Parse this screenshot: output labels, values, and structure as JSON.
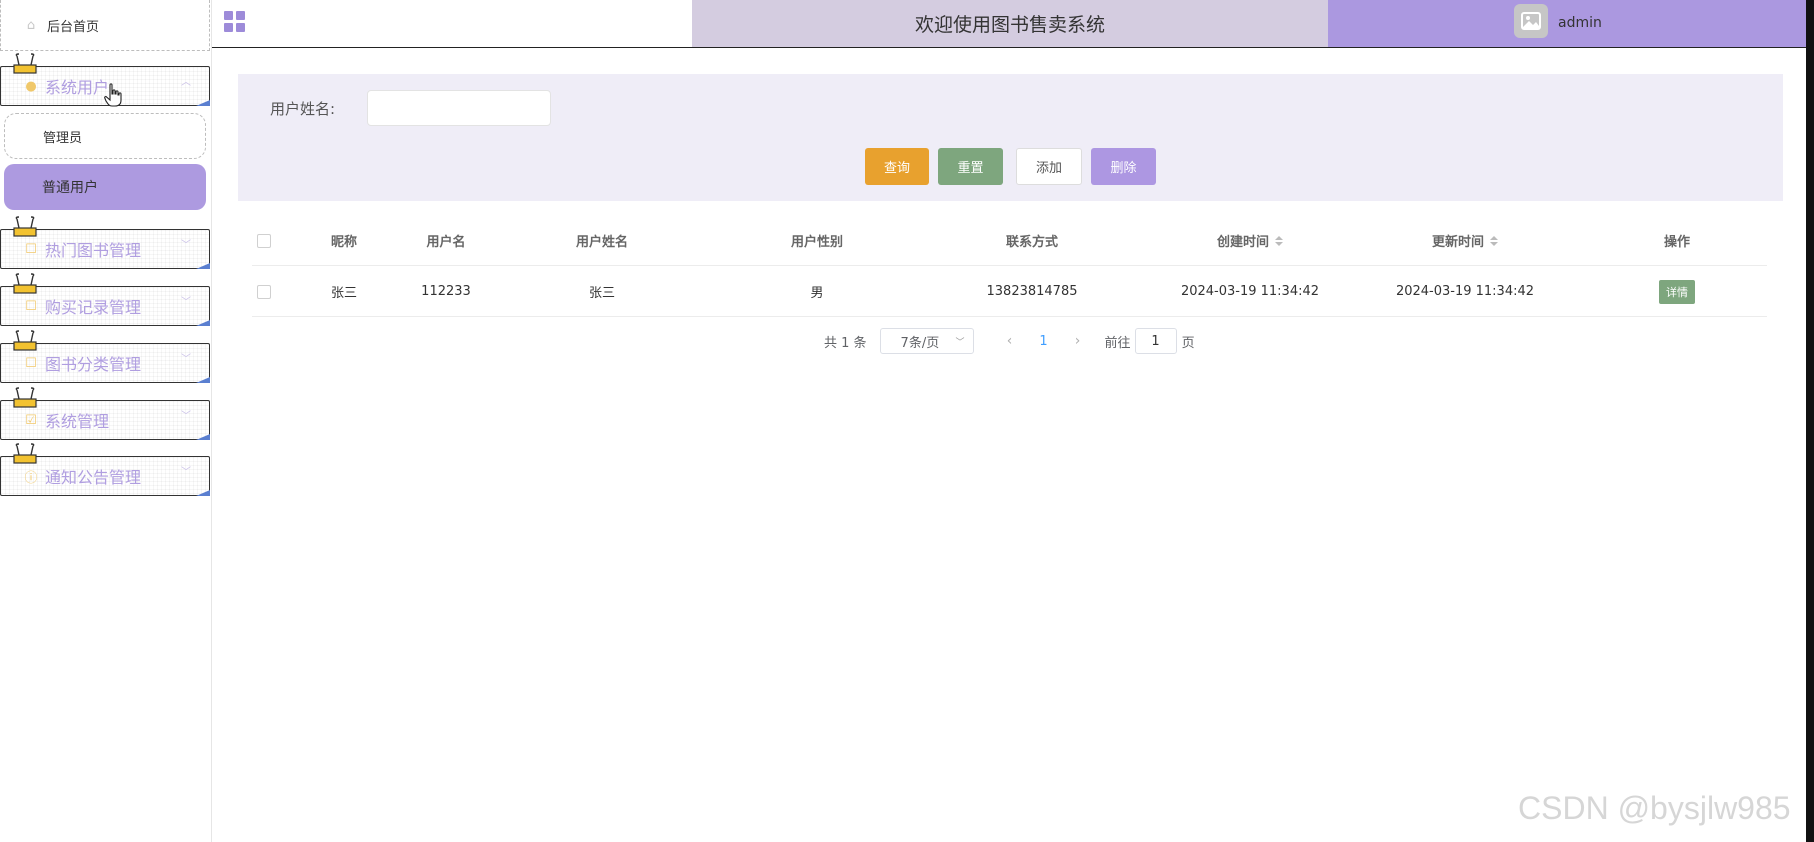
{
  "sidebar": {
    "home": "后台首页",
    "groups": [
      {
        "label": "系统用户"
      },
      {
        "label": "热门图书管理"
      },
      {
        "label": "购买记录管理"
      },
      {
        "label": "图书分类管理"
      },
      {
        "label": "系统管理"
      },
      {
        "label": "通知公告管理"
      }
    ],
    "sub_items": [
      "管理员",
      "普通用户"
    ]
  },
  "header": {
    "title": "欢迎使用图书售卖系统",
    "username": "admin"
  },
  "search": {
    "label": "用户姓名:",
    "value": "",
    "buttons": {
      "query": "查询",
      "reset": "重置",
      "add": "添加",
      "delete": "删除"
    }
  },
  "table": {
    "headers": [
      "昵称",
      "用户名",
      "用户姓名",
      "用户性别",
      "联系方式",
      "创建时间",
      "更新时间",
      "操作"
    ],
    "rows": [
      {
        "nickname": "张三",
        "username": "112233",
        "realname": "张三",
        "gender": "男",
        "phone": "13823814785",
        "created": "2024-03-19 11:34:42",
        "updated": "2024-03-19 11:34:42",
        "action": "详情"
      }
    ]
  },
  "pagination": {
    "total": "共 1 条",
    "page_size": "7条/页",
    "current": "1",
    "goto_prefix": "前往",
    "goto_value": "1",
    "goto_suffix": "页"
  },
  "watermark": "CSDN @bysjlw985",
  "colors": {
    "accent": "#ad9ae0",
    "query": "#e8a12e",
    "reset": "#7ea67e",
    "delete": "#ad97e2",
    "title_bg": "#d4cce0"
  }
}
